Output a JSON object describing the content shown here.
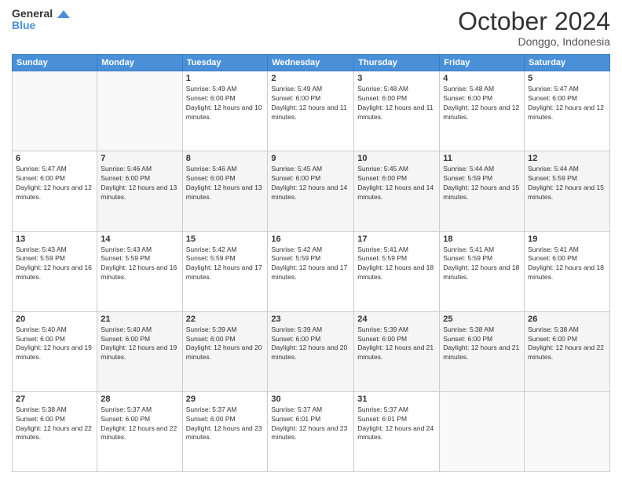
{
  "logo": {
    "line1": "General",
    "line2": "Blue"
  },
  "header": {
    "month": "October 2024",
    "location": "Donggo, Indonesia"
  },
  "weekdays": [
    "Sunday",
    "Monday",
    "Tuesday",
    "Wednesday",
    "Thursday",
    "Friday",
    "Saturday"
  ],
  "weeks": [
    [
      {
        "day": "",
        "sunrise": "",
        "sunset": "",
        "daylight": ""
      },
      {
        "day": "",
        "sunrise": "",
        "sunset": "",
        "daylight": ""
      },
      {
        "day": "1",
        "sunrise": "Sunrise: 5:49 AM",
        "sunset": "Sunset: 6:00 PM",
        "daylight": "Daylight: 12 hours and 10 minutes."
      },
      {
        "day": "2",
        "sunrise": "Sunrise: 5:49 AM",
        "sunset": "Sunset: 6:00 PM",
        "daylight": "Daylight: 12 hours and 11 minutes."
      },
      {
        "day": "3",
        "sunrise": "Sunrise: 5:48 AM",
        "sunset": "Sunset: 6:00 PM",
        "daylight": "Daylight: 12 hours and 11 minutes."
      },
      {
        "day": "4",
        "sunrise": "Sunrise: 5:48 AM",
        "sunset": "Sunset: 6:00 PM",
        "daylight": "Daylight: 12 hours and 12 minutes."
      },
      {
        "day": "5",
        "sunrise": "Sunrise: 5:47 AM",
        "sunset": "Sunset: 6:00 PM",
        "daylight": "Daylight: 12 hours and 12 minutes."
      }
    ],
    [
      {
        "day": "6",
        "sunrise": "Sunrise: 5:47 AM",
        "sunset": "Sunset: 6:00 PM",
        "daylight": "Daylight: 12 hours and 12 minutes."
      },
      {
        "day": "7",
        "sunrise": "Sunrise: 5:46 AM",
        "sunset": "Sunset: 6:00 PM",
        "daylight": "Daylight: 12 hours and 13 minutes."
      },
      {
        "day": "8",
        "sunrise": "Sunrise: 5:46 AM",
        "sunset": "Sunset: 6:00 PM",
        "daylight": "Daylight: 12 hours and 13 minutes."
      },
      {
        "day": "9",
        "sunrise": "Sunrise: 5:45 AM",
        "sunset": "Sunset: 6:00 PM",
        "daylight": "Daylight: 12 hours and 14 minutes."
      },
      {
        "day": "10",
        "sunrise": "Sunrise: 5:45 AM",
        "sunset": "Sunset: 6:00 PM",
        "daylight": "Daylight: 12 hours and 14 minutes."
      },
      {
        "day": "11",
        "sunrise": "Sunrise: 5:44 AM",
        "sunset": "Sunset: 5:59 PM",
        "daylight": "Daylight: 12 hours and 15 minutes."
      },
      {
        "day": "12",
        "sunrise": "Sunrise: 5:44 AM",
        "sunset": "Sunset: 5:59 PM",
        "daylight": "Daylight: 12 hours and 15 minutes."
      }
    ],
    [
      {
        "day": "13",
        "sunrise": "Sunrise: 5:43 AM",
        "sunset": "Sunset: 5:59 PM",
        "daylight": "Daylight: 12 hours and 16 minutes."
      },
      {
        "day": "14",
        "sunrise": "Sunrise: 5:43 AM",
        "sunset": "Sunset: 5:59 PM",
        "daylight": "Daylight: 12 hours and 16 minutes."
      },
      {
        "day": "15",
        "sunrise": "Sunrise: 5:42 AM",
        "sunset": "Sunset: 5:59 PM",
        "daylight": "Daylight: 12 hours and 17 minutes."
      },
      {
        "day": "16",
        "sunrise": "Sunrise: 5:42 AM",
        "sunset": "Sunset: 5:59 PM",
        "daylight": "Daylight: 12 hours and 17 minutes."
      },
      {
        "day": "17",
        "sunrise": "Sunrise: 5:41 AM",
        "sunset": "Sunset: 5:59 PM",
        "daylight": "Daylight: 12 hours and 18 minutes."
      },
      {
        "day": "18",
        "sunrise": "Sunrise: 5:41 AM",
        "sunset": "Sunset: 5:59 PM",
        "daylight": "Daylight: 12 hours and 18 minutes."
      },
      {
        "day": "19",
        "sunrise": "Sunrise: 5:41 AM",
        "sunset": "Sunset: 6:00 PM",
        "daylight": "Daylight: 12 hours and 18 minutes."
      }
    ],
    [
      {
        "day": "20",
        "sunrise": "Sunrise: 5:40 AM",
        "sunset": "Sunset: 6:00 PM",
        "daylight": "Daylight: 12 hours and 19 minutes."
      },
      {
        "day": "21",
        "sunrise": "Sunrise: 5:40 AM",
        "sunset": "Sunset: 6:00 PM",
        "daylight": "Daylight: 12 hours and 19 minutes."
      },
      {
        "day": "22",
        "sunrise": "Sunrise: 5:39 AM",
        "sunset": "Sunset: 6:00 PM",
        "daylight": "Daylight: 12 hours and 20 minutes."
      },
      {
        "day": "23",
        "sunrise": "Sunrise: 5:39 AM",
        "sunset": "Sunset: 6:00 PM",
        "daylight": "Daylight: 12 hours and 20 minutes."
      },
      {
        "day": "24",
        "sunrise": "Sunrise: 5:39 AM",
        "sunset": "Sunset: 6:00 PM",
        "daylight": "Daylight: 12 hours and 21 minutes."
      },
      {
        "day": "25",
        "sunrise": "Sunrise: 5:38 AM",
        "sunset": "Sunset: 6:00 PM",
        "daylight": "Daylight: 12 hours and 21 minutes."
      },
      {
        "day": "26",
        "sunrise": "Sunrise: 5:38 AM",
        "sunset": "Sunset: 6:00 PM",
        "daylight": "Daylight: 12 hours and 22 minutes."
      }
    ],
    [
      {
        "day": "27",
        "sunrise": "Sunrise: 5:38 AM",
        "sunset": "Sunset: 6:00 PM",
        "daylight": "Daylight: 12 hours and 22 minutes."
      },
      {
        "day": "28",
        "sunrise": "Sunrise: 5:37 AM",
        "sunset": "Sunset: 6:00 PM",
        "daylight": "Daylight: 12 hours and 22 minutes."
      },
      {
        "day": "29",
        "sunrise": "Sunrise: 5:37 AM",
        "sunset": "Sunset: 6:00 PM",
        "daylight": "Daylight: 12 hours and 23 minutes."
      },
      {
        "day": "30",
        "sunrise": "Sunrise: 5:37 AM",
        "sunset": "Sunset: 6:01 PM",
        "daylight": "Daylight: 12 hours and 23 minutes."
      },
      {
        "day": "31",
        "sunrise": "Sunrise: 5:37 AM",
        "sunset": "Sunset: 6:01 PM",
        "daylight": "Daylight: 12 hours and 24 minutes."
      },
      {
        "day": "",
        "sunrise": "",
        "sunset": "",
        "daylight": ""
      },
      {
        "day": "",
        "sunrise": "",
        "sunset": "",
        "daylight": ""
      }
    ]
  ]
}
